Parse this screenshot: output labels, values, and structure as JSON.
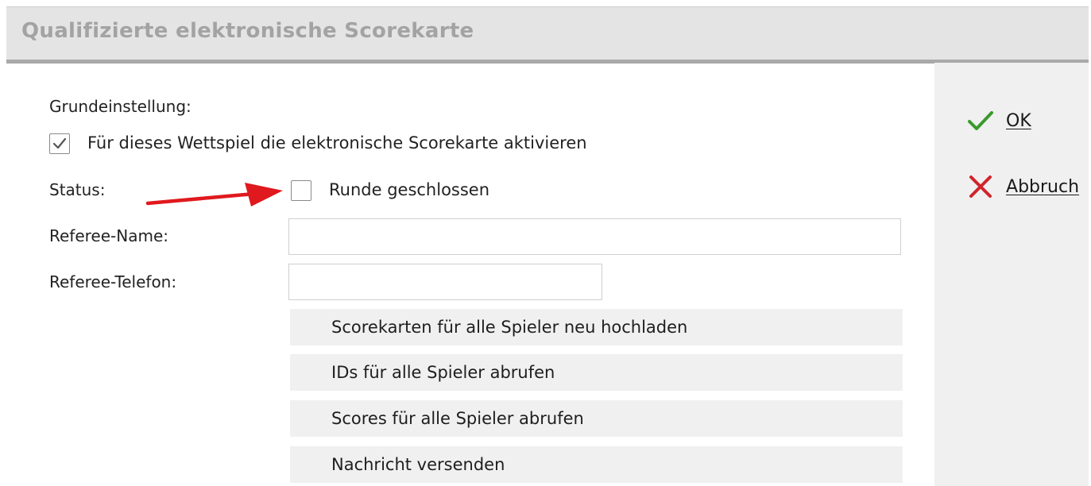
{
  "window": {
    "title": "Qualifizierte elektronische Scorekarte"
  },
  "form": {
    "basic_label": "Grundeinstellung:",
    "activate": {
      "label": "Für dieses Wettspiel die elektronische Scorekarte aktivieren",
      "checked": true
    },
    "status_label": "Status:",
    "round_closed": {
      "label": "Runde geschlossen",
      "checked": false
    },
    "referee_name_label": "Referee-Name:",
    "referee_name_value": "",
    "referee_phone_label": "Referee-Telefon:",
    "referee_phone_value": ""
  },
  "actions": [
    {
      "label": "Scorekarten für alle Spieler neu hochladen"
    },
    {
      "label": "IDs für alle Spieler abrufen"
    },
    {
      "label": "Scores für alle Spieler abrufen"
    },
    {
      "label": "Nachricht versenden"
    }
  ],
  "sidebar": {
    "ok": {
      "mnemonic": "O",
      "rest": "K",
      "icon": "check-icon",
      "color": "#3a9a2a"
    },
    "cancel": {
      "mnemonic": "A",
      "rest": "bbruch",
      "icon": "close-icon",
      "color": "#d0242b"
    }
  },
  "annotation": {
    "icon": "red-arrow",
    "color": "#e0191e"
  }
}
